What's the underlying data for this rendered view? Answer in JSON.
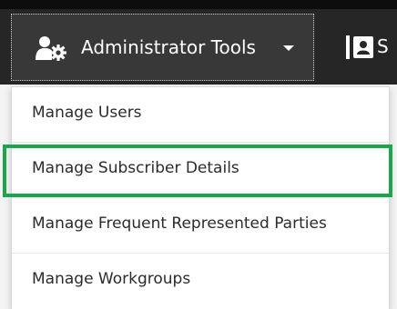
{
  "colors": {
    "navbar_background": "#262626",
    "active_nav_background": "#383838",
    "nav_text": "#ffffff",
    "menu_background": "#ffffff",
    "menu_text": "#2b2b2b",
    "highlight": "#1aa64a"
  },
  "navbar": {
    "items": [
      {
        "label": "Administrator Tools",
        "icon": "users-gear-icon",
        "has_caret": true
      },
      {
        "label": "S",
        "icon": "contact-card-icon"
      }
    ]
  },
  "dropdown": {
    "items": [
      {
        "label": "Manage Users"
      },
      {
        "label": "Manage Subscriber Details",
        "highlighted": true
      },
      {
        "label": "Manage Frequent Represented Parties"
      },
      {
        "label": "Manage Workgroups"
      }
    ]
  }
}
